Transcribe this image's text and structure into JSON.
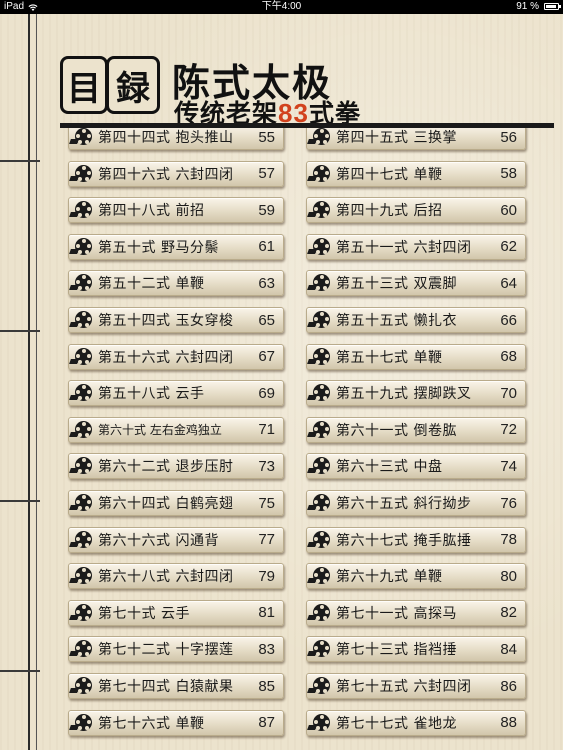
{
  "status_bar": {
    "carrier": "iPad",
    "time": "下午4:00",
    "battery": "91 %",
    "battery_level": 0.91
  },
  "header": {
    "seal_chars": [
      "目",
      "録"
    ],
    "title": "陈式太极",
    "subtitle_prefix": "传统老架",
    "subtitle_number": "83",
    "subtitle_suffix": "式拳",
    "accent_color": "#d2421d"
  },
  "list": {
    "icon": "film-reel-icon",
    "rows": [
      {
        "left": {
          "label": "第四十四式  抱头推山",
          "page": "55"
        },
        "right": {
          "label": "第四十五式  三换掌",
          "page": "56"
        }
      },
      {
        "left": {
          "label": "第四十六式  六封四闭",
          "page": "57"
        },
        "right": {
          "label": "第四十七式  单鞭",
          "page": "58"
        }
      },
      {
        "left": {
          "label": "第四十八式  前招",
          "page": "59"
        },
        "right": {
          "label": "第四十九式  后招",
          "page": "60"
        }
      },
      {
        "left": {
          "label": "第五十式  野马分鬃",
          "page": "61"
        },
        "right": {
          "label": "第五十一式  六封四闭",
          "page": "62"
        }
      },
      {
        "left": {
          "label": "第五十二式  单鞭",
          "page": "63"
        },
        "right": {
          "label": "第五十三式  双震脚",
          "page": "64"
        }
      },
      {
        "left": {
          "label": "第五十四式  玉女穿梭",
          "page": "65"
        },
        "right": {
          "label": "第五十五式  懒扎衣",
          "page": "66"
        }
      },
      {
        "left": {
          "label": "第五十六式  六封四闭",
          "page": "67"
        },
        "right": {
          "label": "第五十七式  单鞭",
          "page": "68"
        }
      },
      {
        "left": {
          "label": "第五十八式  云手",
          "page": "69"
        },
        "right": {
          "label": "第五十九式  摆脚跌叉",
          "page": "70"
        }
      },
      {
        "left": {
          "label": "第六十式  左右金鸡独立",
          "page": "71",
          "small": true
        },
        "right": {
          "label": "第六十一式  倒卷肱",
          "page": "72"
        }
      },
      {
        "left": {
          "label": "第六十二式  退步压肘",
          "page": "73"
        },
        "right": {
          "label": "第六十三式  中盘",
          "page": "74"
        }
      },
      {
        "left": {
          "label": "第六十四式  白鹤亮翅",
          "page": "75"
        },
        "right": {
          "label": "第六十五式  斜行拗步",
          "page": "76"
        }
      },
      {
        "left": {
          "label": "第六十六式  闪通背",
          "page": "77"
        },
        "right": {
          "label": "第六十七式  掩手肱捶",
          "page": "78"
        }
      },
      {
        "left": {
          "label": "第六十八式  六封四闭",
          "page": "79"
        },
        "right": {
          "label": "第六十九式  单鞭",
          "page": "80"
        }
      },
      {
        "left": {
          "label": "第七十式  云手",
          "page": "81"
        },
        "right": {
          "label": "第七十一式  高探马",
          "page": "82"
        }
      },
      {
        "left": {
          "label": "第七十二式  十字摆莲",
          "page": "83"
        },
        "right": {
          "label": "第七十三式  指裆捶",
          "page": "84"
        }
      },
      {
        "left": {
          "label": "第七十四式  白猿献果",
          "page": "85"
        },
        "right": {
          "label": "第七十五式  六封四闭",
          "page": "86"
        }
      },
      {
        "left": {
          "label": "第七十六式  单鞭",
          "page": "87"
        },
        "right": {
          "label": "第七十七式  雀地龙",
          "page": "88"
        }
      }
    ]
  }
}
